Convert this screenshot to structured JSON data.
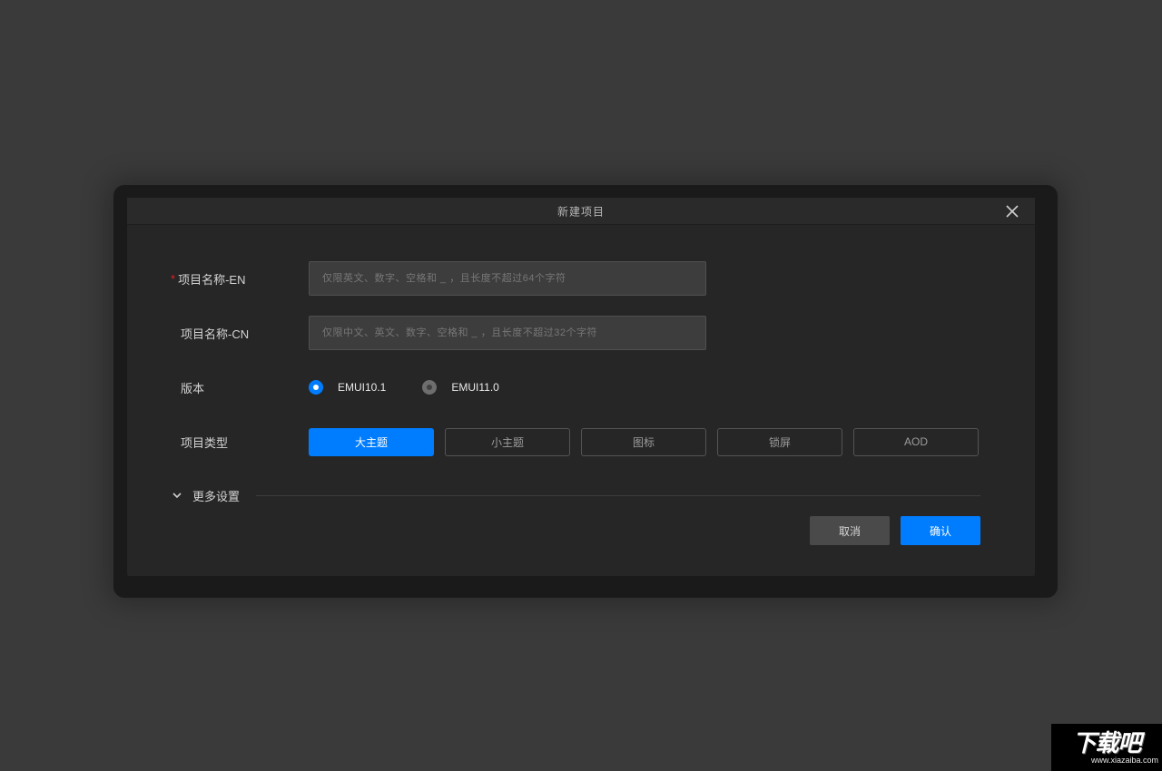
{
  "dialog": {
    "title": "新建项目",
    "close_aria": "close"
  },
  "fields": {
    "name_en": {
      "label": "项目名称-EN",
      "required": true,
      "placeholder": "仅限英文、数字、空格和 _ ，且长度不超过64个字符",
      "value": ""
    },
    "name_cn": {
      "label": "项目名称-CN",
      "required": false,
      "placeholder": "仅限中文、英文、数字、空格和 _ ，且长度不超过32个字符",
      "value": ""
    },
    "version": {
      "label": "版本",
      "options": [
        "EMUI10.1",
        "EMUI11.0"
      ],
      "selected_index": 0
    },
    "project_type": {
      "label": "项目类型",
      "options": [
        "大主题",
        "小主题",
        "图标",
        "锁屏",
        "AOD"
      ],
      "selected_index": 0
    },
    "more": {
      "label": "更多设置"
    }
  },
  "footer": {
    "cancel": "取消",
    "confirm": "确认"
  },
  "watermark": {
    "main": "下载吧",
    "sub": "www.xiazaiba.com"
  },
  "colors": {
    "accent": "#007dff",
    "required": "#e02020"
  }
}
